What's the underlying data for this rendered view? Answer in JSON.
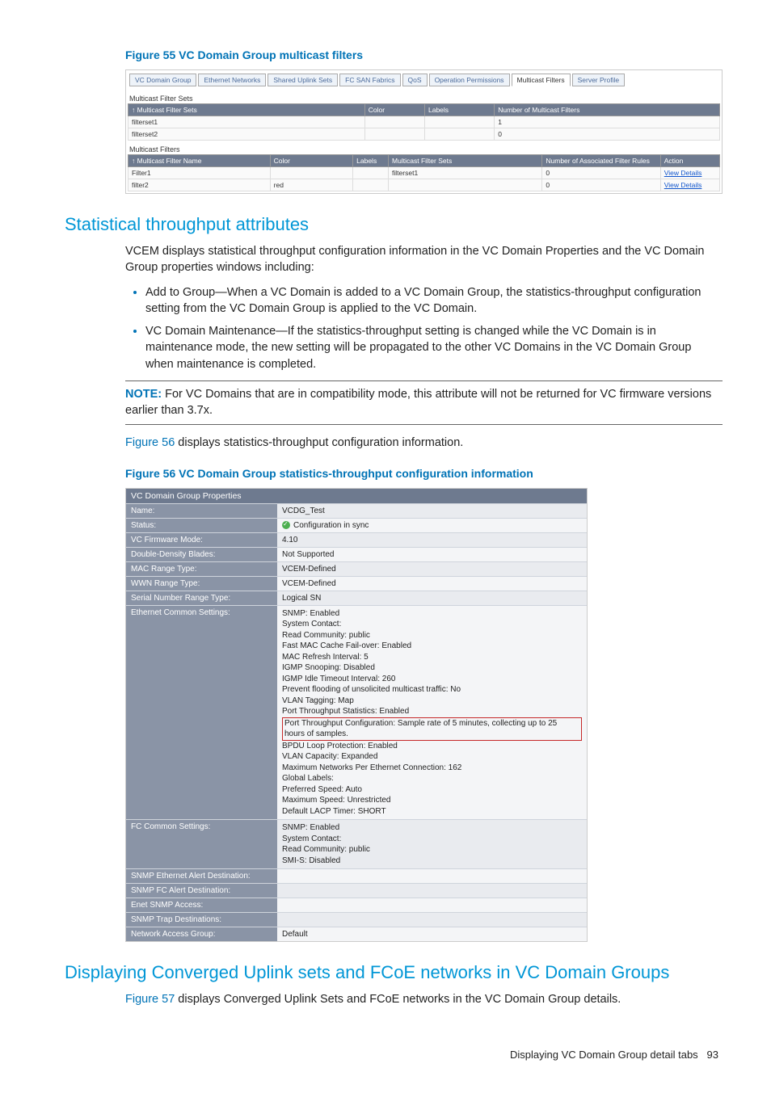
{
  "figure55_title": "Figure 55 VC Domain Group multicast filters",
  "fig55_tabs": [
    "VC Domain Group",
    "Ethernet Networks",
    "Shared Uplink Sets",
    "FC SAN Fabrics",
    "QoS",
    "Operation Permissions",
    "Multicast Filters",
    "Server Profile"
  ],
  "fig55_active_tab_index": 6,
  "fig55_section1_label": "Multicast Filter Sets",
  "fig55_table1_headers": [
    "Multicast Filter Sets",
    "Color",
    "Labels",
    "Number of Multicast Filters"
  ],
  "fig55_table1_sort_prefix": "↑",
  "fig55_table1_rows": [
    {
      "name": "filterset1",
      "color": "",
      "labels": "",
      "count": "1"
    },
    {
      "name": "filterset2",
      "color": "",
      "labels": "",
      "count": "0"
    }
  ],
  "fig55_section2_label": "Multicast Filters",
  "fig55_table2_headers": [
    "Multicast Filter Name",
    "Color",
    "Labels",
    "Multicast Filter Sets",
    "Number of Associated Filter Rules",
    "Action"
  ],
  "fig55_table2_sort_prefix": "↑",
  "fig55_table2_rows": [
    {
      "name": "Filter1",
      "color": "",
      "labels": "",
      "sets": "filterset1",
      "rules": "0",
      "action": "View Details"
    },
    {
      "name": "filter2",
      "color": "red",
      "labels": "",
      "sets": "",
      "rules": "0",
      "action": "View Details"
    }
  ],
  "section1_title": "Statistical throughput attributes",
  "section1_intro": "VCEM displays statistical throughput configuration information in the VC Domain Properties and the VC Domain Group properties windows including:",
  "section1_bullets": [
    "Add to Group—When a VC Domain is added to a VC Domain Group, the statistics-throughput configuration setting from the VC Domain Group is applied to the VC Domain.",
    "VC Domain Maintenance—If the statistics-throughput setting is changed while the VC Domain is in maintenance mode, the new setting will be propagated to the other VC Domains in the VC Domain Group when maintenance is completed."
  ],
  "note_label": "NOTE:",
  "note_text": "For VC Domains that are in compatibility mode, this attribute will not be returned for VC firmware versions earlier than 3.7x.",
  "fig56_lead_link": "Figure 56",
  "fig56_lead_rest": " displays statistics-throughput configuration information.",
  "figure56_title": "Figure 56 VC Domain Group statistics-throughput configuration information",
  "fig56_panel_title": "VC Domain Group Properties",
  "fig56_rows": [
    {
      "label": "Name:",
      "value": "VCDG_Test",
      "alt": true
    },
    {
      "label": "Status:",
      "value": "Configuration in sync",
      "alt": false,
      "status_icon": true
    },
    {
      "label": "VC Firmware Mode:",
      "value": "4.10",
      "alt": true
    },
    {
      "label": "Double-Density Blades:",
      "value": "Not Supported",
      "alt": false
    },
    {
      "label": "MAC Range Type:",
      "value": "VCEM-Defined",
      "alt": true
    },
    {
      "label": "WWN Range Type:",
      "value": "VCEM-Defined",
      "alt": false
    },
    {
      "label": "Serial Number Range Type:",
      "value": "Logical SN",
      "alt": true
    }
  ],
  "fig56_eth_label": "Ethernet Common Settings:",
  "fig56_eth_lines": [
    "SNMP: Enabled",
    "System Contact:",
    "Read Community: public",
    "Fast MAC Cache Fail-over: Enabled",
    "MAC Refresh Interval: 5",
    "IGMP Snooping: Disabled",
    "IGMP Idle Timeout Interval: 260",
    "Prevent flooding of unsolicited multicast traffic: No",
    "VLAN Tagging: Map",
    "Port Throughput Statistics: Enabled"
  ],
  "fig56_eth_boxed": "Port Throughput Configuration: Sample rate of 5 minutes, collecting up to 25 hours of samples.",
  "fig56_eth_lines_after": [
    "BPDU Loop Protection: Enabled",
    "VLAN Capacity: Expanded",
    "Maximum Networks Per Ethernet Connection: 162",
    "Global Labels:",
    "Preferred Speed: Auto",
    "Maximum Speed: Unrestricted",
    "Default LACP Timer: SHORT"
  ],
  "fig56_fc_label": "FC Common Settings:",
  "fig56_fc_lines": [
    "SNMP: Enabled",
    "System Contact:",
    "Read Community: public",
    "SMI-S: Disabled"
  ],
  "fig56_simple_after": [
    {
      "label": "SNMP Ethernet Alert Destination:",
      "value": "",
      "alt": false
    },
    {
      "label": "SNMP FC Alert Destination:",
      "value": "",
      "alt": true
    },
    {
      "label": "Enet SNMP Access:",
      "value": "",
      "alt": false
    },
    {
      "label": "SNMP Trap Destinations:",
      "value": "",
      "alt": true
    },
    {
      "label": "Network Access Group:",
      "value": "Default",
      "alt": false
    }
  ],
  "section2_title": "Displaying Converged Uplink sets and FCoE networks in VC Domain Groups",
  "fig57_lead_link": "Figure 57",
  "fig57_lead_rest": " displays Converged Uplink Sets and FCoE networks in the VC Domain Group details.",
  "footer_text": "Displaying VC Domain Group detail tabs",
  "footer_page": "93"
}
